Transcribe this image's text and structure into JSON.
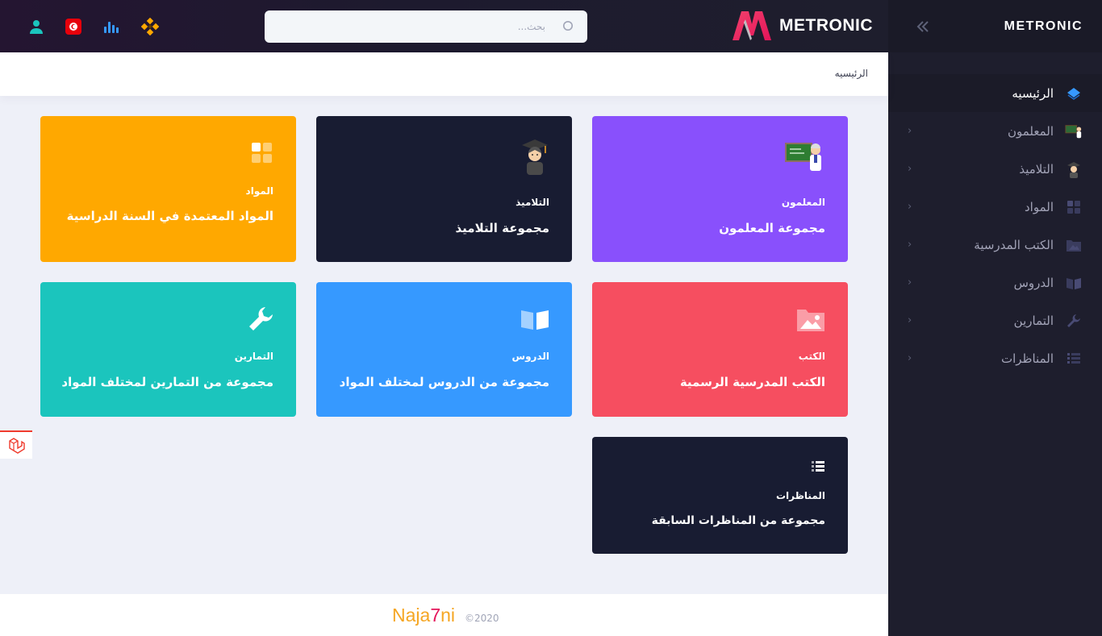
{
  "topbar": {
    "icons": [
      "user-icon",
      "flag-tunisia-icon",
      "bar-chart-icon",
      "apps-icon"
    ],
    "search_placeholder": "بحث...",
    "logo_text": "METRONIC"
  },
  "sidebar": {
    "brand": "METRONIC",
    "items": [
      {
        "label": "الرئيسيه",
        "icon": "layers-icon",
        "active": true
      },
      {
        "label": "المعلمون",
        "icon": "teacher-icon"
      },
      {
        "label": "التلاميذ",
        "icon": "student-icon"
      },
      {
        "label": "المواد",
        "icon": "grid-icon"
      },
      {
        "label": "الكتب المدرسية",
        "icon": "picture-folder-icon"
      },
      {
        "label": "الدروس",
        "icon": "book-icon"
      },
      {
        "label": "التمارين",
        "icon": "wrench-icon"
      },
      {
        "label": "المناظرات",
        "icon": "list-icon"
      }
    ]
  },
  "breadcrumb": "الرئيسيه",
  "cards": [
    {
      "title": "المعلمون",
      "subtitle": "مجموعة المعلمون",
      "color": "#8950fc",
      "icon": "teacher-board-icon"
    },
    {
      "title": "التلاميذ",
      "subtitle": "مجموعة التلاميذ",
      "color": "#181c32",
      "icon": "graduate-icon"
    },
    {
      "title": "المواد",
      "subtitle": "المواد المعتمدة في السنة الدراسية",
      "color": "#ffa800",
      "icon": "grid-icon"
    },
    {
      "title": "الكتب",
      "subtitle": "الكتب المدرسية الرسمية",
      "color": "#f64e60",
      "icon": "picture-folder-icon"
    },
    {
      "title": "الدروس",
      "subtitle": "مجموعة من الدروس لمختلف المواد",
      "color": "#3699ff",
      "icon": "book-icon"
    },
    {
      "title": "التمارين",
      "subtitle": "مجموعة من التمارين لمختلف المواد",
      "color": "#1bc5bd",
      "icon": "wrench-icon"
    },
    {
      "title": "المناظرات",
      "subtitle": "مجموعة من المناظرات السابقة",
      "color": "#181c32",
      "icon": "list-icon"
    }
  ],
  "footer": {
    "brand_a": "Naja",
    "brand_b": "7",
    "brand_c": "ni",
    "year": "©2020"
  },
  "colors": {
    "sidebar": "#1e1e2d",
    "accent": "#3699ff",
    "footer_brand": "#f5a623"
  }
}
